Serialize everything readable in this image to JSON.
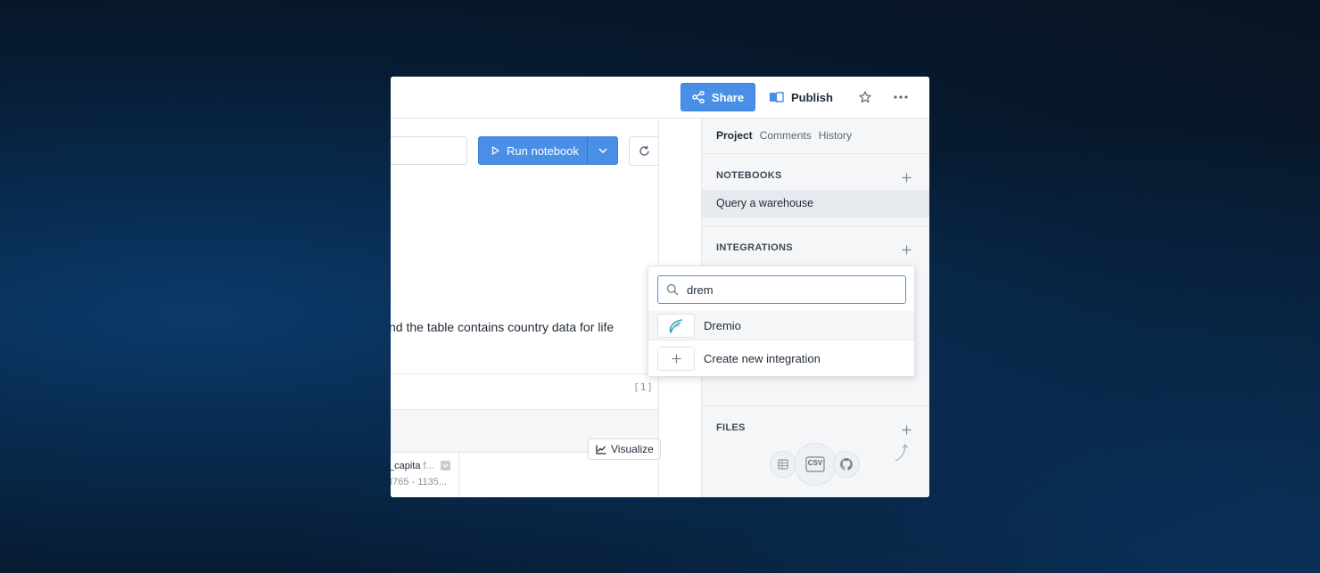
{
  "topbar": {
    "share_label": "Share",
    "publish_label": "Publish"
  },
  "toolbar": {
    "run_label": "Run notebook"
  },
  "content": {
    "description": "nd the table contains country data for life",
    "cell_number": "[1]",
    "visualize_label": "Visualize",
    "column": {
      "name": "_capita",
      "type": "f...",
      "range": "3765 - 1135..."
    }
  },
  "sidebar": {
    "tabs": [
      "Project",
      "Comments",
      "History"
    ],
    "notebooks_title": "NOTEBOOKS",
    "notebook_item": "Query a warehouse",
    "integrations_title": "INTEGRATIONS",
    "files_title": "FILES",
    "file_icons": [
      "sheets-icon",
      "csv-icon",
      "github-icon"
    ],
    "csv_label": "CSV"
  },
  "integration_dropdown": {
    "search_value": "drem",
    "items": [
      {
        "label": "Dremio",
        "icon": "dremio-icon"
      },
      {
        "label": "Create new integration",
        "icon": "plus-icon"
      }
    ]
  },
  "colors": {
    "accent": "#4a8fe6",
    "sidebar_bg": "#f4f6f8"
  }
}
